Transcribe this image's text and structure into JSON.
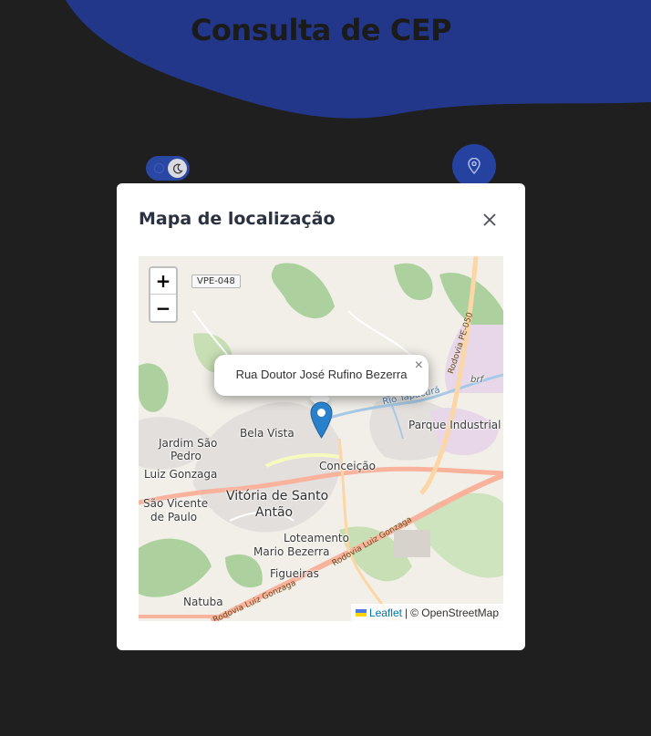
{
  "header": {
    "title": "Consulta de CEP"
  },
  "colors": {
    "accent": "#23378a",
    "page_bg": "#1f1f1f",
    "button": "#2542a1"
  },
  "toolbar": {
    "theme_toggle_icon": "moon-icon",
    "locate_icon": "map-pin-icon"
  },
  "modal": {
    "title": "Mapa de localização",
    "close_icon": "close-icon"
  },
  "map": {
    "zoom_in": "+",
    "zoom_out": "−",
    "shield": "VPE-048",
    "popup_text": "Rua Doutor José Rufino Bezerra",
    "popup_close": "×",
    "marker_icon": "map-marker-icon",
    "labels": {
      "bela_vista": "Bela Vista",
      "jardim_sao_pedro_1": "Jardim São",
      "jardim_sao_pedro_2": "Pedro",
      "luiz_gonzaga": "Luiz Gonzaga",
      "conceicao": "Conceição",
      "vitoria_1": "Vitória de Santo",
      "vitoria_2": "Antão",
      "sao_vicente_1": "São Vicente",
      "sao_vicente_2": "de Paulo",
      "loteamento_1": "Loteamento",
      "loteamento_2": "Mario Bezerra",
      "figueiras": "Figueiras",
      "natuba": "Natuba",
      "parque_industrial": "Parque Industrial",
      "brf": "brf",
      "rio_tapacura": "Rio Tapacurá",
      "rodovia_pe050": "Rodovia PE-050",
      "rodovia_luiz_gonzaga_1": "Rodovia Luiz Gonzaga",
      "rodovia_luiz_gonzaga_2": "Rodovia Luiz Gonzaga"
    },
    "attribution": {
      "leaflet": "Leaflet",
      "separator": "|",
      "osm": "© OpenStreetMap"
    }
  }
}
